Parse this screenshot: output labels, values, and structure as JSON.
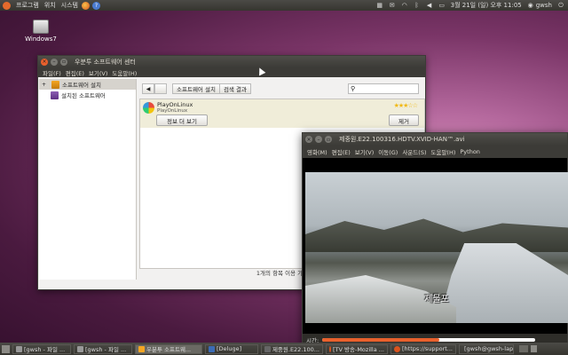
{
  "top_panel": {
    "menus": [
      "프로그램",
      "위치",
      "시스템"
    ],
    "clock": "3월 21일 (일) 오후 11:05",
    "user": "gwsh"
  },
  "desktop": {
    "icons": [
      {
        "label": "Windows7",
        "icon": "drive-icon"
      }
    ]
  },
  "software_center": {
    "title": "우분투 소프트웨어 센터",
    "menu": [
      "파일(F)",
      "편집(E)",
      "보기(V)",
      "도움말(H)"
    ],
    "sidebar": [
      {
        "label": "소프트웨어 설치",
        "icon": "install-icon",
        "active": true
      },
      {
        "label": "설치된 소프트웨어",
        "icon": "installed-icon",
        "active": false
      }
    ],
    "breadcrumbs": [
      "소프트웨어 설치",
      "검색 결과"
    ],
    "search": {
      "value": "",
      "icon": "search-icon"
    },
    "result": {
      "name": "PlayOnLinux",
      "subtitle": "PlayOnLinux",
      "stars": "★★★☆☆",
      "more_info_label": "정보 더 보기",
      "remove_label": "제거"
    },
    "status": "1개의 항목 이용 가능"
  },
  "video_player": {
    "title": "제중원.E22.100316.HDTV.XVID-HAN™.avi",
    "menu": [
      "영화(M)",
      "편집(E)",
      "보기(V)",
      "이동(G)",
      "사운드(S)",
      "도움말(H)",
      "Python"
    ],
    "subtitle": "제물포",
    "time_label": "시간:",
    "progress": 0.55
  },
  "taskbar": [
    {
      "label": "[gwsh - 파일 ..."
    },
    {
      "label": "[gwsh - 파일 ..."
    },
    {
      "label": "우분투 소프트웨...",
      "active": true
    },
    {
      "label": "[Deluge]"
    },
    {
      "label": "제중원.E22.100..."
    },
    {
      "label": "[TV 방송-Mozilla ..."
    },
    {
      "label": "[https://support..."
    },
    {
      "label": "[gwsh@gwsh-lap..."
    }
  ]
}
